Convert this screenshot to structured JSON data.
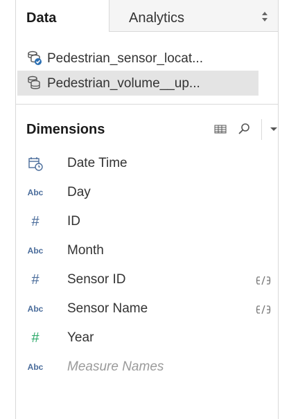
{
  "tabs": {
    "data_label": "Data",
    "analytics_label": "Analytics"
  },
  "data_sources": [
    {
      "label": "Pedestrian_sensor_locat...",
      "icon": "database-connected-icon",
      "selected": false
    },
    {
      "label": "Pedestrian_volume__up...",
      "icon": "database-icon",
      "selected": true
    }
  ],
  "dimensions": {
    "title": "Dimensions",
    "fields": [
      {
        "icon": "calendar-icon",
        "name": "Date Time"
      },
      {
        "icon": "abc",
        "icon_text": "Abc",
        "name": "Day"
      },
      {
        "icon": "hash",
        "icon_text": "#",
        "name": "ID"
      },
      {
        "icon": "abc",
        "icon_text": "Abc",
        "name": "Month"
      },
      {
        "icon": "hash",
        "icon_text": "#",
        "name": "Sensor ID",
        "linked": true
      },
      {
        "icon": "abc",
        "icon_text": "Abc",
        "name": "Sensor Name",
        "linked": true
      },
      {
        "icon": "hash-green",
        "icon_text": "#",
        "name": "Year"
      },
      {
        "icon": "abc",
        "icon_text": "Abc",
        "name": "Measure Names",
        "italic": true
      }
    ]
  },
  "colors": {
    "dimension_blue": "#4a6c9b",
    "measure_green": "#2eaa6b",
    "selected_bg": "#e4e4e4"
  }
}
